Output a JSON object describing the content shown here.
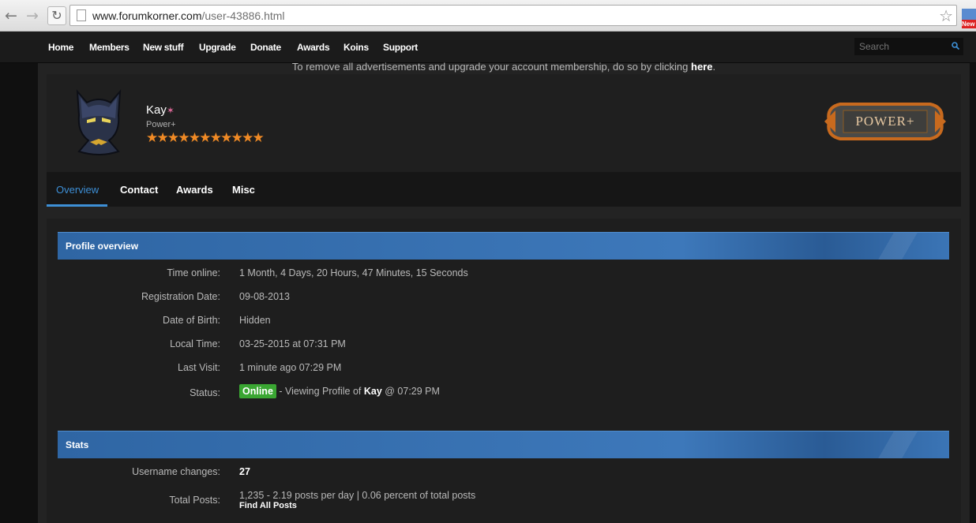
{
  "browser": {
    "url_host": "www.forumkorner.com",
    "url_path": "/user-43886.html",
    "ext_badge": "New"
  },
  "nav": {
    "items": [
      "Home",
      "Members",
      "New stuff",
      "Upgrade",
      "Donate",
      "Awards",
      "Koins",
      "Support"
    ],
    "search_placeholder": "Search"
  },
  "notice": {
    "text": "To remove all advertisements and upgrade your account membership, do so by clicking ",
    "link": "here",
    "end": "."
  },
  "profile": {
    "username": "Kay",
    "username_mark": "✶",
    "usertitle": "Power+",
    "stars": 11,
    "group_badge": "POWER+"
  },
  "tabs": [
    "Overview",
    "Contact",
    "Awards",
    "Misc"
  ],
  "overview": {
    "title": "Profile overview",
    "rows": [
      {
        "label": "Time online:",
        "value": "1 Month, 4 Days, 20 Hours, 47 Minutes, 15 Seconds"
      },
      {
        "label": "Registration Date:",
        "value": "09-08-2013"
      },
      {
        "label": "Date of Birth:",
        "value": "Hidden"
      },
      {
        "label": "Local Time:",
        "value": "03-25-2015 at 07:31 PM"
      },
      {
        "label": "Last Visit:",
        "value": "1 minute ago 07:29 PM"
      }
    ],
    "status": {
      "label": "Status:",
      "badge": "Online",
      "pre": " - Viewing Profile of ",
      "viewer": "Kay",
      "post": " @ 07:29 PM"
    }
  },
  "stats": {
    "title": "Stats",
    "username_changes_label": "Username changes:",
    "username_changes": "27",
    "total_posts_label": "Total Posts:",
    "total_posts": "1,235 - 2.19 posts per day | 0.06 percent of total posts",
    "find_posts": "Find All Posts"
  },
  "colors": {
    "accent": "#3d8fd6",
    "header_blue": "#3a72b2",
    "online_green": "#3aa632",
    "star_orange": "#f08a25"
  }
}
